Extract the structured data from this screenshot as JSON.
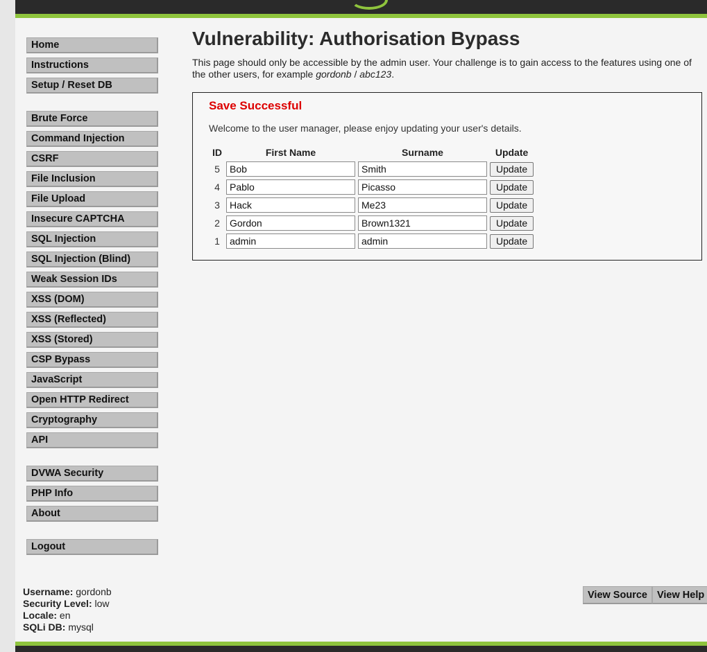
{
  "nav": {
    "group1": [
      {
        "label": "Home"
      },
      {
        "label": "Instructions"
      },
      {
        "label": "Setup / Reset DB"
      }
    ],
    "group2": [
      {
        "label": "Brute Force"
      },
      {
        "label": "Command Injection"
      },
      {
        "label": "CSRF"
      },
      {
        "label": "File Inclusion"
      },
      {
        "label": "File Upload"
      },
      {
        "label": "Insecure CAPTCHA"
      },
      {
        "label": "SQL Injection"
      },
      {
        "label": "SQL Injection (Blind)"
      },
      {
        "label": "Weak Session IDs"
      },
      {
        "label": "XSS (DOM)"
      },
      {
        "label": "XSS (Reflected)"
      },
      {
        "label": "XSS (Stored)"
      },
      {
        "label": "CSP Bypass"
      },
      {
        "label": "JavaScript"
      },
      {
        "label": "Open HTTP Redirect"
      },
      {
        "label": "Cryptography"
      },
      {
        "label": "API"
      }
    ],
    "group3": [
      {
        "label": "DVWA Security"
      },
      {
        "label": "PHP Info"
      },
      {
        "label": "About"
      }
    ],
    "group4": [
      {
        "label": "Logout"
      }
    ]
  },
  "main": {
    "title": "Vulnerability: Authorisation Bypass",
    "intro_text": "This page should only be accessible by the admin user. Your challenge is to gain access to the features using one of the other users, for example ",
    "intro_user": "gordonb",
    "intro_sep": " / ",
    "intro_pass": "abc123",
    "intro_end": ".",
    "save_message": "Save Successful",
    "welcome": "Welcome to the user manager, please enjoy updating your user's details.",
    "table": {
      "headers": {
        "id": "ID",
        "first_name": "First Name",
        "surname": "Surname",
        "update": "Update"
      },
      "rows": [
        {
          "id": "5",
          "first_name": "Bob",
          "surname": "Smith",
          "button": "Update"
        },
        {
          "id": "4",
          "first_name": "Pablo",
          "surname": "Picasso",
          "button": "Update"
        },
        {
          "id": "3",
          "first_name": "Hack",
          "surname": "Me23",
          "button": "Update"
        },
        {
          "id": "2",
          "first_name": "Gordon",
          "surname": "Brown1321",
          "button": "Update"
        },
        {
          "id": "1",
          "first_name": "admin",
          "surname": "admin",
          "button": "Update"
        }
      ]
    }
  },
  "status": {
    "username_label": "Username:",
    "username": "gordonb",
    "security_label": "Security Level:",
    "security": "low",
    "locale_label": "Locale:",
    "locale": "en",
    "sqli_label": "SQLi DB:",
    "sqli": "mysql"
  },
  "buttons": {
    "view_source": "View Source",
    "view_help": "View Help"
  },
  "colors": {
    "accent_green": "#8fc43d",
    "header_dark": "#2a2a2a",
    "error_red": "#dd0000"
  }
}
